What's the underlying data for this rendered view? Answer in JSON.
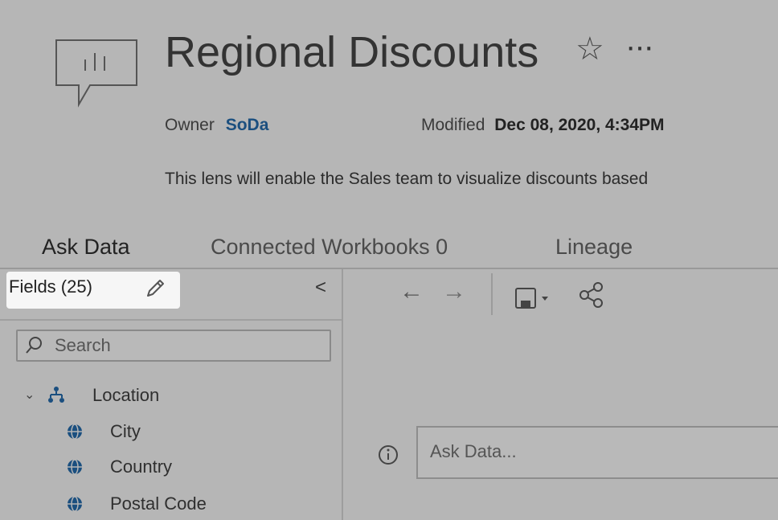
{
  "header": {
    "title": "Regional Discounts",
    "more_label": "···",
    "owner_label": "Owner",
    "owner_name": "SoDa",
    "modified_label": "Modified",
    "modified_value": "Dec 08, 2020, 4:34PM",
    "description": "This lens will enable the Sales team to visualize discounts based"
  },
  "tabs": [
    {
      "label": "Ask Data",
      "active": true
    },
    {
      "label": "Connected Workbooks 0",
      "active": false
    },
    {
      "label": "Lineage",
      "active": false
    }
  ],
  "fields_panel": {
    "label": "Fields (25)",
    "collapse_glyph": "<",
    "search_placeholder": "Search",
    "tree": {
      "group": "Location",
      "items": [
        "City",
        "Country",
        "Postal Code"
      ]
    }
  },
  "toolbar": {
    "back_glyph": "←",
    "forward_glyph": "→"
  },
  "ask": {
    "placeholder": "Ask Data..."
  },
  "colors": {
    "background": "#b6b6b6",
    "highlight": "#f6f6f6",
    "owner_link": "#1b4f7f"
  },
  "icons": [
    "lens-icon",
    "star-icon",
    "pencil-icon",
    "search-icon",
    "hierarchy-icon",
    "globe-icon",
    "info-icon",
    "save-icon",
    "share-icon"
  ]
}
